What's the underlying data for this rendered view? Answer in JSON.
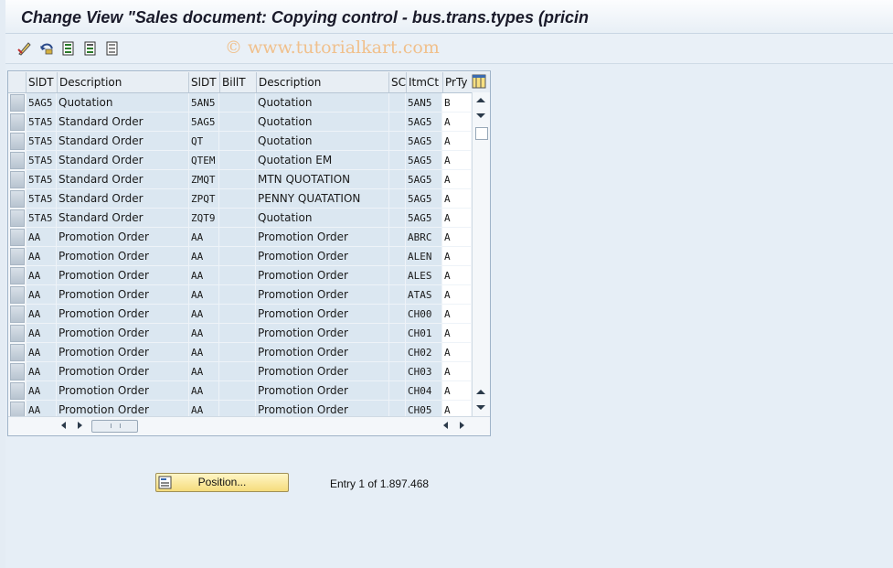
{
  "window": {
    "title": "Change View \"Sales document: Copying control - bus.trans.types (pricin"
  },
  "watermark": "© www.tutorialkart.com",
  "toolbar": {
    "icons": [
      "edit-icon",
      "undo-icon",
      "select-all-icon",
      "select-block-icon",
      "deselect-all-icon"
    ]
  },
  "table": {
    "columns": [
      "SlDT",
      "Description",
      "SlDT",
      "BillT",
      "Description",
      "SC",
      "ItmCt",
      "PrTy"
    ],
    "rows": [
      [
        "5AG5",
        "Quotation",
        "5AN5",
        "",
        "Quotation",
        "",
        "5AN5",
        "B"
      ],
      [
        "5TA5",
        "Standard Order",
        "5AG5",
        "",
        "Quotation",
        "",
        "5AG5",
        "A"
      ],
      [
        "5TA5",
        "Standard Order",
        "QT",
        "",
        "Quotation",
        "",
        "5AG5",
        "A"
      ],
      [
        "5TA5",
        "Standard Order",
        "QTEM",
        "",
        "Quotation EM",
        "",
        "5AG5",
        "A"
      ],
      [
        "5TA5",
        "Standard Order",
        "ZMQT",
        "",
        "MTN QUOTATION",
        "",
        "5AG5",
        "A"
      ],
      [
        "5TA5",
        "Standard Order",
        "ZPQT",
        "",
        "PENNY QUATATION",
        "",
        "5AG5",
        "A"
      ],
      [
        "5TA5",
        "Standard Order",
        "ZQT9",
        "",
        "Quotation",
        "",
        "5AG5",
        "A"
      ],
      [
        "AA",
        "Promotion Order",
        "AA",
        "",
        "Promotion Order",
        "",
        "ABRC",
        "A"
      ],
      [
        "AA",
        "Promotion Order",
        "AA",
        "",
        "Promotion Order",
        "",
        "ALEN",
        "A"
      ],
      [
        "AA",
        "Promotion Order",
        "AA",
        "",
        "Promotion Order",
        "",
        "ALES",
        "A"
      ],
      [
        "AA",
        "Promotion Order",
        "AA",
        "",
        "Promotion Order",
        "",
        "ATAS",
        "A"
      ],
      [
        "AA",
        "Promotion Order",
        "AA",
        "",
        "Promotion Order",
        "",
        "CH00",
        "A"
      ],
      [
        "AA",
        "Promotion Order",
        "AA",
        "",
        "Promotion Order",
        "",
        "CH01",
        "A"
      ],
      [
        "AA",
        "Promotion Order",
        "AA",
        "",
        "Promotion Order",
        "",
        "CH02",
        "A"
      ],
      [
        "AA",
        "Promotion Order",
        "AA",
        "",
        "Promotion Order",
        "",
        "CH03",
        "A"
      ],
      [
        "AA",
        "Promotion Order",
        "AA",
        "",
        "Promotion Order",
        "",
        "CH04",
        "A"
      ],
      [
        "AA",
        "Promotion Order",
        "AA",
        "",
        "Promotion Order",
        "",
        "CH05",
        "A"
      ]
    ]
  },
  "footer": {
    "position_button": "Position...",
    "entry_text": "Entry 1 of 1.897.468"
  }
}
